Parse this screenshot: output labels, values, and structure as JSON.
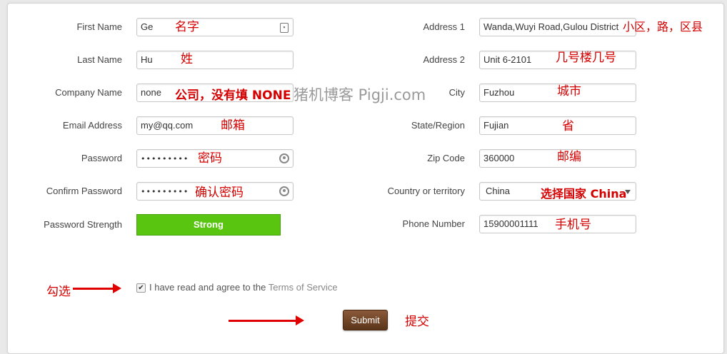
{
  "form": {
    "left_fields": [
      {
        "label": "First Name",
        "value": "Ge"
      },
      {
        "label": "Last Name",
        "value": "Hu"
      },
      {
        "label": "Company Name",
        "value": "none"
      },
      {
        "label": "Email Address",
        "value": "my@qq.com"
      },
      {
        "label": "Password",
        "value": "•••••••••"
      },
      {
        "label": "Confirm Password",
        "value": "•••••••••"
      }
    ],
    "strength_label": "Password Strength",
    "strength_value": "Strong",
    "right_fields": [
      {
        "label": "Address 1",
        "value": "Wanda,Wuyi Road,Gulou District"
      },
      {
        "label": "Address 2",
        "value": "Unit 6-2101"
      },
      {
        "label": "City",
        "value": "Fuzhou"
      },
      {
        "label": "State/Region",
        "value": "Fujian"
      },
      {
        "label": "Zip Code",
        "value": "360000"
      },
      {
        "label": "Country or territory",
        "value": "China"
      },
      {
        "label": "Phone Number",
        "value": "15900001111"
      }
    ],
    "agree_text": "I have read and agree to the",
    "terms_link": "Terms of Service",
    "submit_label": "Submit"
  },
  "annotations": {
    "first_name": "名字",
    "last_name": "姓",
    "company": "公司，没有填 NONE",
    "email": "邮箱",
    "password": "密码",
    "confirm_password": "确认密码",
    "address1": "小区，路，区县",
    "address2": "几号楼几号",
    "city": "城市",
    "state": "省",
    "zip": "邮编",
    "country": "选择国家 China",
    "phone": "手机号",
    "check": "勾选",
    "submit": "提交"
  },
  "watermark": "猪机博客 Pigji.com",
  "colors": {
    "strength_green": "#5ac511",
    "submit_brown": "#6e4323",
    "annotation_red": "#d40000"
  }
}
